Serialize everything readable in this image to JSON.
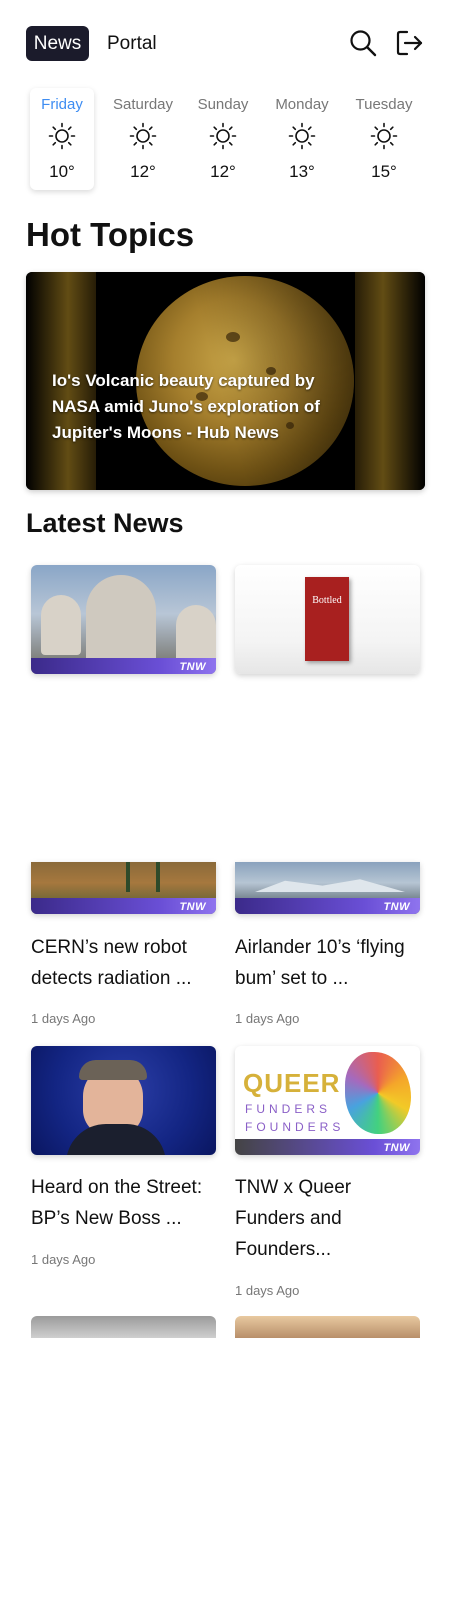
{
  "header": {
    "logo_news": "News",
    "logo_portal": "Portal"
  },
  "weather": {
    "days": [
      {
        "name": "Friday",
        "temp": "10°",
        "icon": "sun-icon",
        "active": true
      },
      {
        "name": "Saturday",
        "temp": "12°",
        "icon": "sun-icon"
      },
      {
        "name": "Sunday",
        "temp": "12°",
        "icon": "sun-icon"
      },
      {
        "name": "Monday",
        "temp": "13°",
        "icon": "sun-icon"
      },
      {
        "name": "Tuesday",
        "temp": "15°",
        "icon": "sun-icon"
      }
    ]
  },
  "hot_topics": {
    "title": "Hot Topics",
    "caption": "Io's Volcanic beauty captured by NASA amid Juno's exploration of Jupiter's Moons - Hub News"
  },
  "latest_news": {
    "title": "Latest News",
    "tnw_mark": "TNW",
    "book_title": "Bottled",
    "queer_logo": {
      "line1": "QUEER",
      "line2": "FUNDERS",
      "line3": "FOUNDERS"
    },
    "articles": [
      {
        "title": "CERN’s new robot detects radiation ...",
        "time": "1 days Ago"
      },
      {
        "title": "Airlander 10’s ‘flying bum’ set to ...",
        "time": "1 days Ago"
      },
      {
        "title": "Heard on the Street: BP’s New Boss ...",
        "time": "1 days Ago"
      },
      {
        "title": "TNW x Queer Funders and Founders...",
        "time": "1 days Ago"
      }
    ]
  },
  "colors": {
    "accent": "#3e8df2",
    "logo_bg": "#1b1b2b",
    "tnw_strip": "#6a4fd6"
  }
}
